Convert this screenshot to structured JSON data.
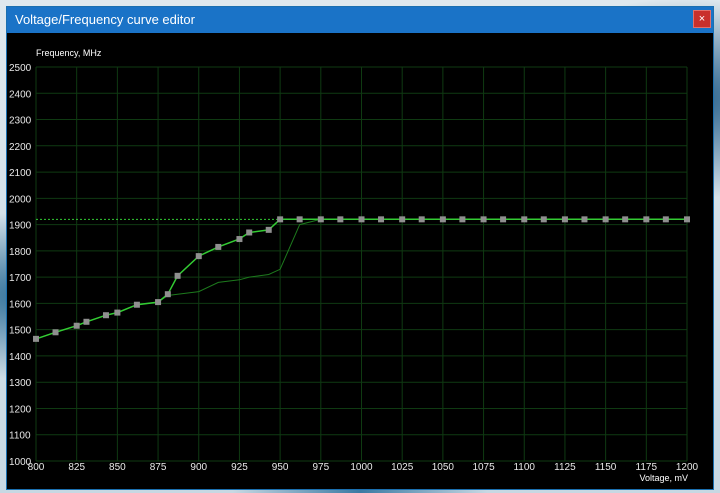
{
  "window": {
    "title": "Voltage/Frequency curve editor",
    "close_icon": "×"
  },
  "colors": {
    "titlebar": "#1a73c7",
    "close": "#c9302c",
    "background": "#000000",
    "grid": "#0f3a12",
    "curve": "#33cc33",
    "base_curve": "#1d7a1d",
    "point": "#8f8f8f"
  },
  "chart_data": {
    "type": "line",
    "xlabel": "Voltage, mV",
    "ylabel": "Frequency, MHz",
    "xlim": [
      800,
      1200
    ],
    "ylim": [
      1000,
      2500
    ],
    "x_ticks": [
      800,
      825,
      850,
      875,
      900,
      925,
      950,
      975,
      1000,
      1025,
      1050,
      1075,
      1100,
      1125,
      1150,
      1175,
      1200
    ],
    "y_ticks": [
      1000,
      1100,
      1200,
      1300,
      1400,
      1500,
      1600,
      1700,
      1800,
      1900,
      2000,
      2100,
      2200,
      2300,
      2400,
      2500
    ],
    "grid": true,
    "limit_line": 1920,
    "series": [
      {
        "x": [
          800,
          812,
          825,
          831,
          843,
          850,
          862,
          875,
          881,
          887,
          900,
          912,
          925,
          931,
          943,
          950,
          962,
          975,
          987,
          1000,
          1012,
          1025,
          1037,
          1050,
          1062,
          1075,
          1087,
          1100,
          1112,
          1125,
          1137,
          1150,
          1162,
          1175,
          1187,
          1200
        ],
        "y": [
          1465,
          1490,
          1515,
          1530,
          1555,
          1565,
          1595,
          1605,
          1635,
          1705,
          1780,
          1815,
          1845,
          1870,
          1880,
          1920,
          1920,
          1920,
          1920,
          1920,
          1920,
          1920,
          1920,
          1920,
          1920,
          1920,
          1920,
          1920,
          1920,
          1920,
          1920,
          1920,
          1920,
          1920,
          1920,
          1920
        ],
        "points": true
      },
      {
        "x": [
          800,
          812,
          825,
          831,
          843,
          850,
          862,
          875,
          881,
          887,
          900,
          912,
          925,
          931,
          943,
          950,
          962,
          975,
          987,
          1000,
          1012,
          1025,
          1037,
          1050,
          1062,
          1075,
          1087,
          1100,
          1112,
          1125,
          1137,
          1150,
          1162,
          1175,
          1187,
          1200
        ],
        "y": [
          1465,
          1490,
          1515,
          1530,
          1555,
          1565,
          1595,
          1605,
          1630,
          1635,
          1645,
          1680,
          1690,
          1700,
          1710,
          1730,
          1900,
          1920,
          1920,
          1920,
          1920,
          1920,
          1920,
          1920,
          1920,
          1920,
          1920,
          1920,
          1920,
          1920,
          1920,
          1920,
          1920,
          1920,
          1920,
          1920
        ],
        "points": false
      }
    ]
  }
}
